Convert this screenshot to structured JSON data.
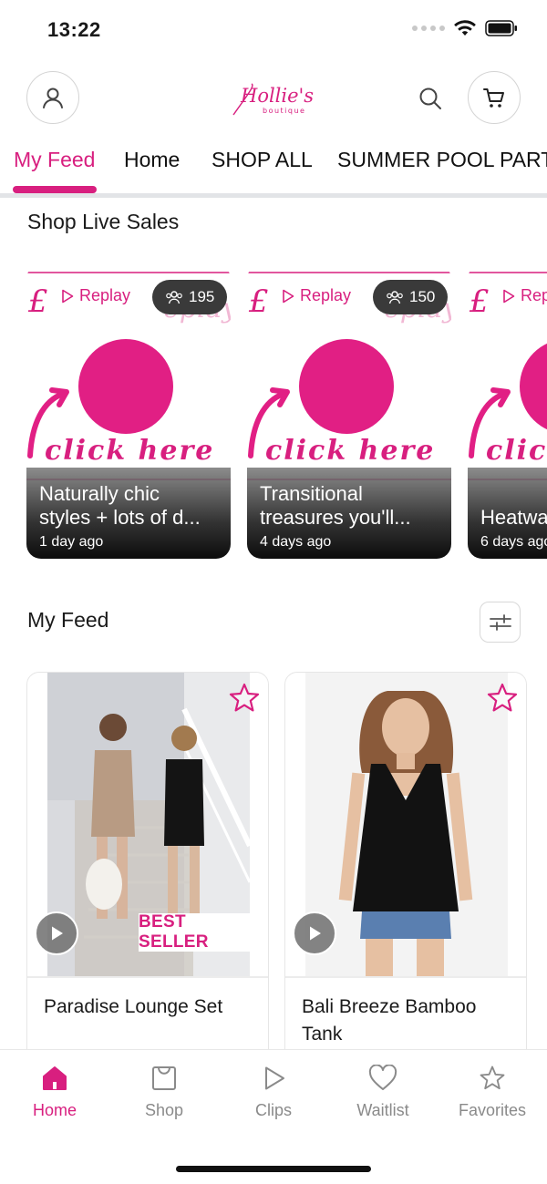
{
  "status_bar": {
    "time": "13:22"
  },
  "header": {
    "logo_text": "Hollie's",
    "logo_subtext": "boutique"
  },
  "tabs": [
    {
      "label": "My Feed",
      "active": true
    },
    {
      "label": "Home",
      "active": false
    },
    {
      "label": "SHOP ALL",
      "active": false
    },
    {
      "label": "SUMMER POOL PARTY",
      "active": false
    }
  ],
  "live_section": {
    "title": "Shop Live Sales",
    "cards": [
      {
        "replay_label": "Replay",
        "viewers": "195",
        "art_text": "click here",
        "title_line1": "Naturally chic",
        "title_line2": "styles + lots of d...",
        "time": "1 day ago"
      },
      {
        "replay_label": "Replay",
        "viewers": "150",
        "art_text": "click here",
        "title_line1": "Transitional",
        "title_line2": "treasures you'll...",
        "time": "4 days ago"
      },
      {
        "replay_label": "Replay",
        "art_text": "click here",
        "title_line1": "Heatwave",
        "title_line2": "",
        "time": "6 days ago"
      }
    ]
  },
  "feed_section": {
    "title": "My Feed",
    "products": [
      {
        "name": "Paradise Lounge Set",
        "badge": "BEST SELLER"
      },
      {
        "name": "Bali Breeze Bamboo Tank",
        "badge": ""
      }
    ]
  },
  "bottom_nav": [
    {
      "label": "Home",
      "icon": "home-icon",
      "active": true
    },
    {
      "label": "Shop",
      "icon": "shopping-bag-icon",
      "active": false
    },
    {
      "label": "Clips",
      "icon": "play-icon",
      "active": false
    },
    {
      "label": "Waitlist",
      "icon": "heart-icon",
      "active": false
    },
    {
      "label": "Favorites",
      "icon": "star-icon",
      "active": false
    }
  ],
  "colors": {
    "accent": "#d81f7f",
    "inactive": "#8a8a8a",
    "divider": "#e2e4e7"
  }
}
